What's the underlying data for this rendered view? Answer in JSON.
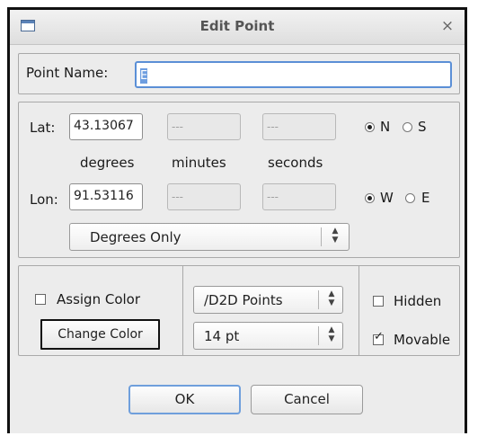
{
  "dialog": {
    "title": "Edit Point",
    "close_glyph": "×",
    "icon": "window-icon"
  },
  "point_name": {
    "label": "Point Name:",
    "value": "E"
  },
  "lat": {
    "label": "Lat:",
    "degrees_value": "43.13067",
    "minutes_value": "---",
    "seconds_value": "---",
    "hemisphere_options": [
      "N",
      "S"
    ],
    "selected_hemisphere": "N"
  },
  "lon": {
    "label": "Lon:",
    "degrees_value": "91.53116",
    "minutes_value": "---",
    "seconds_value": "---",
    "hemisphere_options": [
      "W",
      "E"
    ],
    "selected_hemisphere": "W"
  },
  "unit_labels": {
    "degrees": "degrees",
    "minutes": "minutes",
    "seconds": "seconds"
  },
  "format_select": {
    "selected": "Degrees Only"
  },
  "color": {
    "assign_label": "Assign Color",
    "assign_checked": false,
    "change_button": "Change Color"
  },
  "layer_select": {
    "selected": "/D2D Points"
  },
  "size_select": {
    "selected": "14 pt"
  },
  "options": {
    "hidden_label": "Hidden",
    "hidden_checked": false,
    "movable_label": "Movable",
    "movable_checked": true
  },
  "buttons": {
    "ok": "OK",
    "cancel": "Cancel"
  }
}
